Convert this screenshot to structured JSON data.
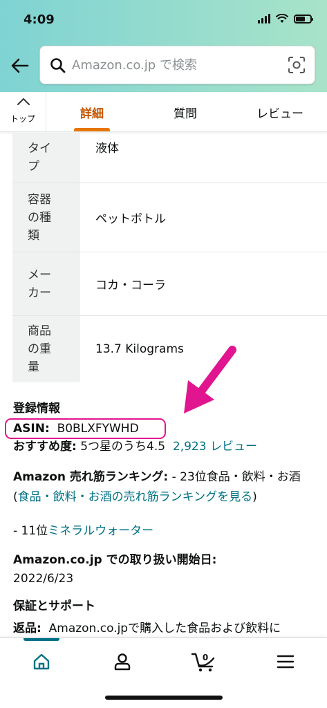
{
  "status_bar": {
    "time": "4:09"
  },
  "search": {
    "placeholder": "Amazon.co.jp で検索"
  },
  "tabs": {
    "top_label": "トップ",
    "items": [
      {
        "label": "詳細",
        "active": true
      },
      {
        "label": "質問",
        "active": false
      },
      {
        "label": "レビュー",
        "active": false
      }
    ]
  },
  "spec_table": [
    {
      "key": "タイプ",
      "value": "液体"
    },
    {
      "key": "容器の種類",
      "value": "ペットボトル"
    },
    {
      "key": "メーカー",
      "value": "コカ・コーラ"
    },
    {
      "key": "商品の重量",
      "value": "13.7 Kilograms"
    }
  ],
  "registration": {
    "heading": "登録情報",
    "asin_label": "ASIN:",
    "asin_value": "B0BLXFYWHD",
    "rating_label": "おすすめ度:",
    "rating_text": "5つ星のうち4.5",
    "reviews_link": "2,923 レビュー",
    "ranking_label": "Amazon 売れ筋ランキング:",
    "ranking_text": "- 23位食品・飲料・お酒 (",
    "ranking_link": "食品・飲料・お酒の売れ筋ランキングを見る",
    "ranking_close": ")",
    "subrank_prefix": "- 11位",
    "subrank_link": "ミネラルウォーター",
    "start_date_label": "Amazon.co.jp での取り扱い開始日:",
    "start_date_value": "2022/6/23",
    "warranty_heading": "保証とサポート",
    "returns_label": "返品:",
    "returns_text": "Amazon.co.jpで購入した食品および飲料に"
  },
  "colors": {
    "accent": "#c45500",
    "link": "#007185",
    "highlight": "#e0158f"
  },
  "bottom_nav": [
    "home-icon",
    "account-icon",
    "cart-icon",
    "menu-icon"
  ],
  "cart_count": "0"
}
